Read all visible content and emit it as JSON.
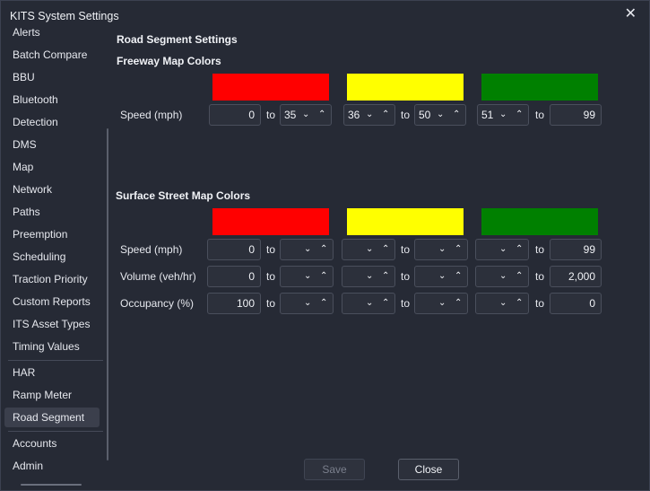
{
  "window": {
    "title": "KITS System Settings"
  },
  "sidebar": {
    "items": [
      "Alerts",
      "Batch Compare",
      "BBU",
      "Bluetooth",
      "Detection",
      "DMS",
      "Map",
      "Network",
      "Paths",
      "Preemption",
      "Scheduling",
      "Traction Priority",
      "Custom Reports",
      "ITS Asset Types",
      "Timing Values"
    ],
    "group2": [
      "HAR",
      "Ramp Meter",
      "Road Segment"
    ],
    "group3": [
      "Accounts",
      "Admin"
    ],
    "active": "Road Segment"
  },
  "main": {
    "title": "Road Segment Settings",
    "freeway": {
      "heading": "Freeway Map Colors",
      "colors": [
        "#ff0000",
        "#ffff00",
        "#008000"
      ],
      "speed_label": "Speed (mph)",
      "to": "to",
      "values": [
        "0",
        "35",
        "36",
        "50",
        "51",
        "99"
      ]
    },
    "surface": {
      "heading": "Surface Street Map Colors",
      "colors": [
        "#ff0000",
        "#ffff00",
        "#008000"
      ],
      "to": "to",
      "speed_label": "Speed (mph)",
      "speed_start": "0",
      "speed_end": "99",
      "volume_label": "Volume (veh/hr)",
      "volume_start": "0",
      "volume_end": "2,000",
      "occupancy_label": "Occupancy (%)",
      "occupancy_start": "100",
      "occupancy_end": "0"
    }
  },
  "footer": {
    "save_label": "Save",
    "close_label": "Close"
  },
  "icons": {
    "close": "✕",
    "down": "⌄",
    "up": "⌃"
  }
}
